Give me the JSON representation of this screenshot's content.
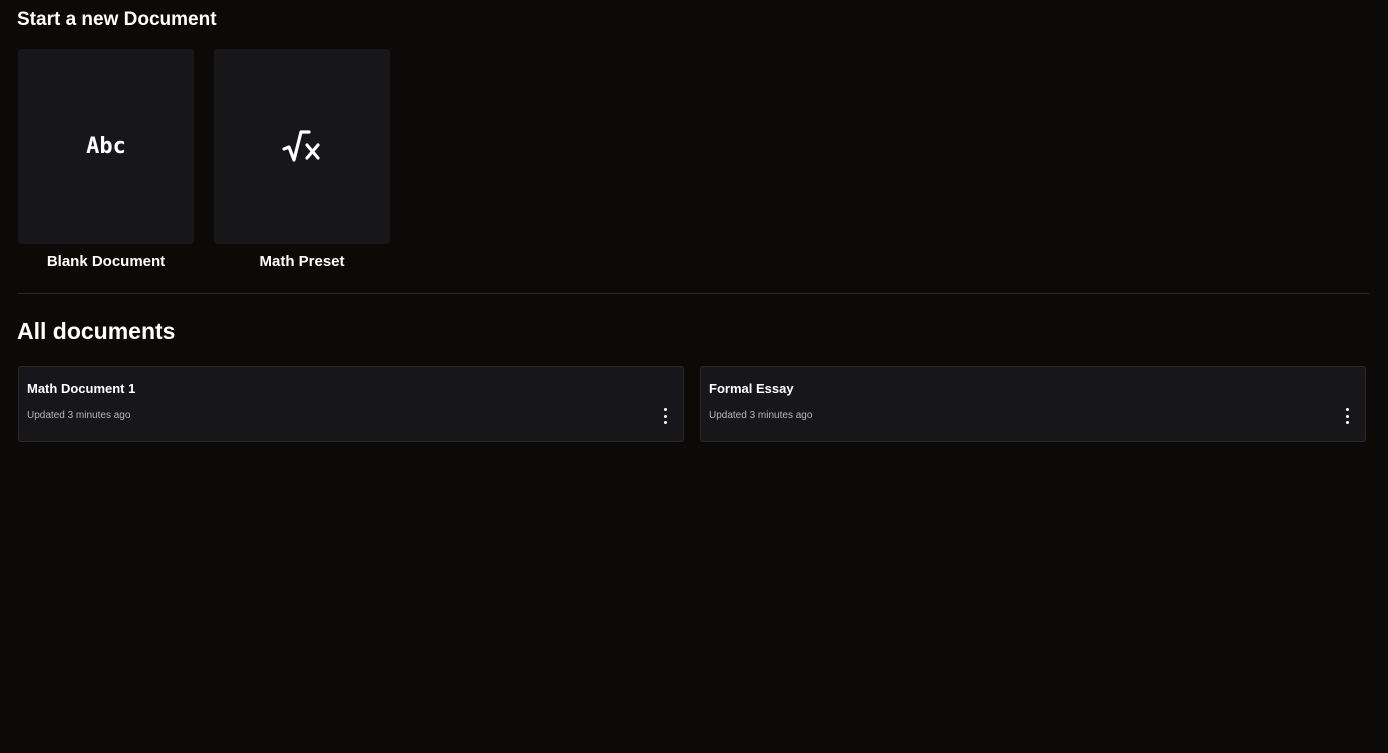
{
  "new_section": {
    "title": "Start a new Document",
    "templates": [
      {
        "label": "Blank Document",
        "icon": "abc-text-icon",
        "glyph": "Abc"
      },
      {
        "label": "Math Preset",
        "icon": "square-root-icon"
      }
    ]
  },
  "all_section": {
    "title": "All documents",
    "documents": [
      {
        "title": "Math Document 1",
        "updated": "Updated 3 minutes ago",
        "menu_icon": "more-vertical-icon"
      },
      {
        "title": "Formal Essay",
        "updated": "Updated 3 minutes ago",
        "menu_icon": "more-vertical-icon"
      }
    ]
  },
  "colors": {
    "background": "#0b0a09",
    "card": "#171619",
    "text": "#ffffff",
    "muted_text": "#b9b6b4",
    "divider": "#2a2828"
  }
}
